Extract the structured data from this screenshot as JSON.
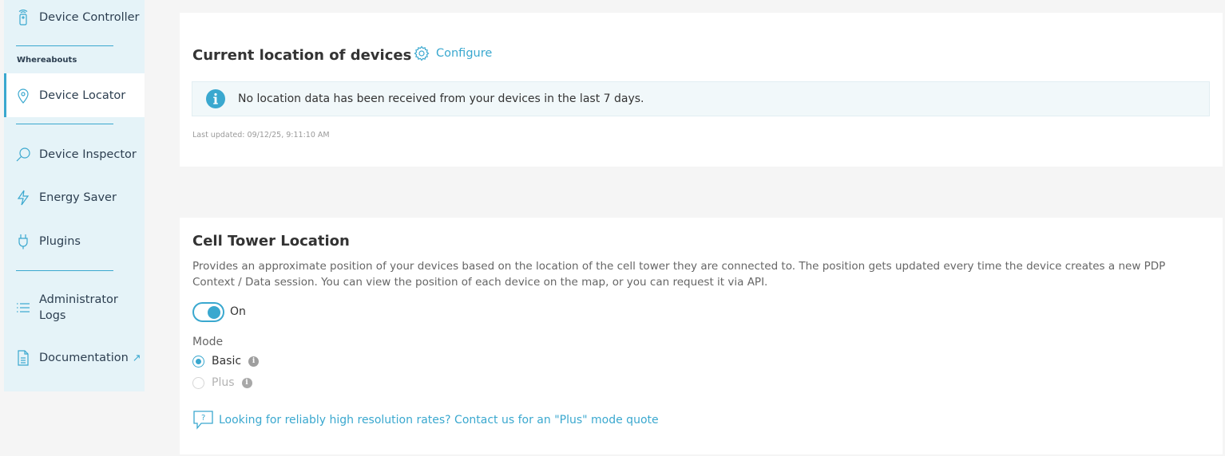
{
  "sidebar": {
    "items": {
      "device_controller": "Device Controller",
      "device_locator": "Device Locator",
      "device_inspector": "Device Inspector",
      "energy_saver": "Energy Saver",
      "plugins": "Plugins",
      "administrator_logs": "Administrator\nLogs",
      "documentation": "Documentation"
    },
    "section_whereabouts": "Whereabouts",
    "active_item": "device_locator",
    "external_link_icon": "external-link-icon"
  },
  "location_card": {
    "title": "Current location of devices",
    "configure_label": "Configure",
    "info_message": "No location data has been received from your devices in the last 7 days.",
    "last_updated": "Last updated: 09/12/25, 9:11:10 AM"
  },
  "cell_tower_card": {
    "title": "Cell Tower Location",
    "description": "Provides an approximate position of your devices based on the location of the cell tower they are connected to. The position gets updated every time the device creates a new PDP Context / Data session. You can view the position of each device on the map, or you can request it via API.",
    "toggle": {
      "label": "On",
      "enabled": true
    },
    "mode": {
      "label": "Mode",
      "options": [
        {
          "label": "Basic",
          "selected": true,
          "disabled": false
        },
        {
          "label": "Plus",
          "selected": false,
          "disabled": true
        }
      ]
    },
    "contact_link": "Looking for reliably high resolution rates? Contact us for an \"Plus\" mode quote"
  },
  "colors": {
    "accent": "#3aa8cf",
    "sidebar_bg": "#e5f3f8",
    "page_bg": "#f5f5f5",
    "info_bg": "#f1f8fa"
  }
}
